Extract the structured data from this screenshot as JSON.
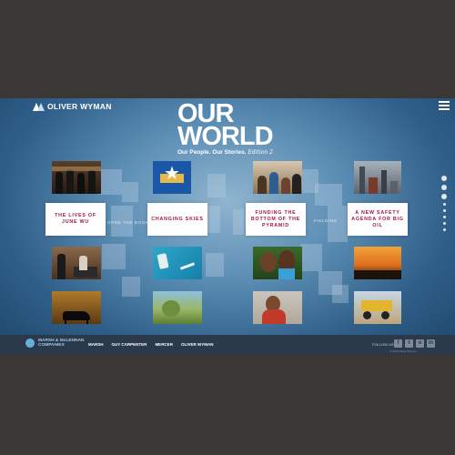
{
  "header": {
    "brand": "OLIVER WYMAN",
    "title_line1": "OUR",
    "title_line2": "WORLD",
    "subtitle": "Our People. Our Stories.",
    "edition": "Edition 2"
  },
  "stories": [
    {
      "label": "THE LIVES OF JUNE WU"
    },
    {
      "label": "CHANGING SKIES"
    },
    {
      "label": "FUNDING THE BOTTOM OF THE PYRAMID"
    },
    {
      "label": "A NEW SAFETY AGENDA FOR BIG OIL"
    }
  ],
  "ghost_labels": [
    "OPEN THE BOOKS",
    "FIELDING"
  ],
  "footer": {
    "parent_line1": "MARSH & McLENNAN",
    "parent_line2": "COMPANIES",
    "links": [
      "MARSH",
      "GUY CARPENTER",
      "MERCER",
      "OLIVER WYMAN"
    ],
    "follow_label": "FOLLOW US",
    "socials": [
      "f",
      "t",
      "o",
      "in"
    ],
    "copyright": "© 2014 Oliver Wyman"
  },
  "colors": {
    "accent": "#a3124a",
    "background": "#3b3734",
    "footer": "#2a3a4b"
  },
  "icons": [
    "oliver-wyman-logo-icon",
    "hamburger-menu-icon",
    "marsh-mclennan-logo-icon"
  ]
}
